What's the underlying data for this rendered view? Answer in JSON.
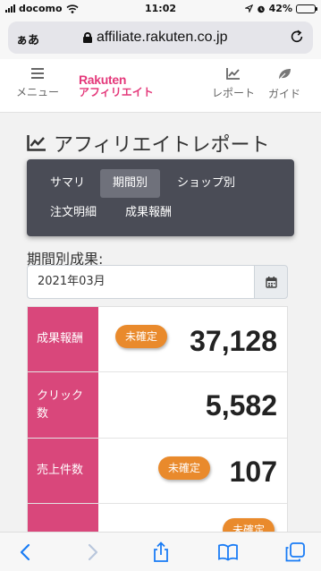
{
  "status_bar": {
    "carrier": "docomo",
    "time": "11:02",
    "battery": "42%",
    "battery_level": 0.42
  },
  "browser": {
    "text_size_label": "ぁあ",
    "url": "affiliate.rakuten.co.jp"
  },
  "header": {
    "menu_label": "メニュー",
    "logo_line1": "Rakuten",
    "logo_line2": "アフィリエイト",
    "report_label": "レポート",
    "guide_label": "ガイド"
  },
  "page": {
    "title": "アフィリエイトレポート",
    "tabs": [
      {
        "label": "サマリ",
        "active": false
      },
      {
        "label": "期間別",
        "active": true
      },
      {
        "label": "ショップ別",
        "active": false
      },
      {
        "label": "注文明細",
        "active": false
      },
      {
        "label": "成果報酬",
        "active": false
      }
    ],
    "period_label": "期間別成果:",
    "period_value": "2021年03月"
  },
  "summary": {
    "rows": [
      {
        "label": "成果報酬",
        "value": "37,128",
        "badge": "未確定"
      },
      {
        "label": "クリック数",
        "value": "5,582",
        "badge": ""
      },
      {
        "label": "売上件数",
        "value": "107",
        "badge": "未確定"
      },
      {
        "label": "",
        "value": "",
        "badge": "未確定"
      }
    ]
  },
  "colors": {
    "brand_pink": "#e4387a",
    "label_pink": "#d9477b",
    "badge_orange": "#e98a2c",
    "tab_bg": "#4a4c56",
    "ios_blue": "#1a7cf5"
  },
  "icons": {
    "menu": "hamburger-icon",
    "report": "line-chart-icon",
    "guide": "leaf-icon",
    "calendar": "calendar-icon",
    "back": "chevron-left-icon",
    "forward": "chevron-right-icon",
    "share": "share-icon",
    "bookmarks": "book-icon",
    "tabs": "tabs-icon"
  }
}
